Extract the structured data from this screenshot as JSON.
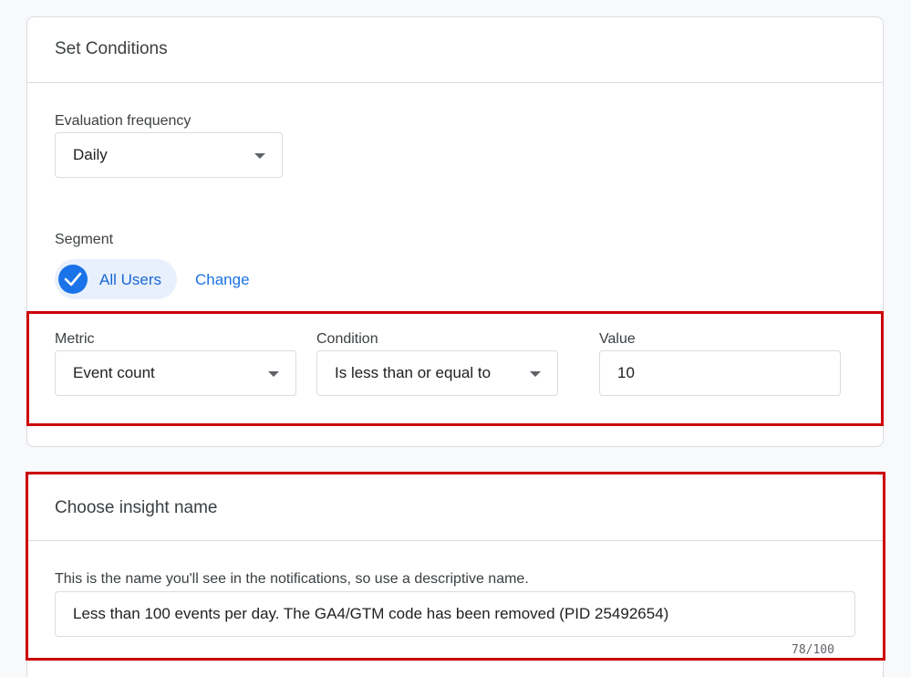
{
  "conditions": {
    "title": "Set Conditions",
    "evaluation_frequency": {
      "label": "Evaluation frequency",
      "value": "Daily"
    },
    "segment": {
      "label": "Segment",
      "chip_label": "All Users",
      "change_label": "Change"
    },
    "metric": {
      "label": "Metric",
      "value": "Event count"
    },
    "condition": {
      "label": "Condition",
      "value": "Is less than or equal to"
    },
    "value": {
      "label": "Value",
      "value": "10"
    }
  },
  "insight": {
    "title": "Choose insight name",
    "helper_text": "This is the name you'll see in the notifications, so use a descriptive name.",
    "name_value": "Less than 100 events per day. The GA4/GTM code has been removed (PID 25492654)",
    "char_counter": "78/100"
  },
  "colors": {
    "accent": "#1a73e8",
    "chip_bg": "#e8f0fe",
    "highlight_border": "#cc0000",
    "page_bg": "#f8f9fa"
  },
  "icons": {
    "dropdown": "chevron-down-icon",
    "chip_check": "check-circle-icon"
  }
}
